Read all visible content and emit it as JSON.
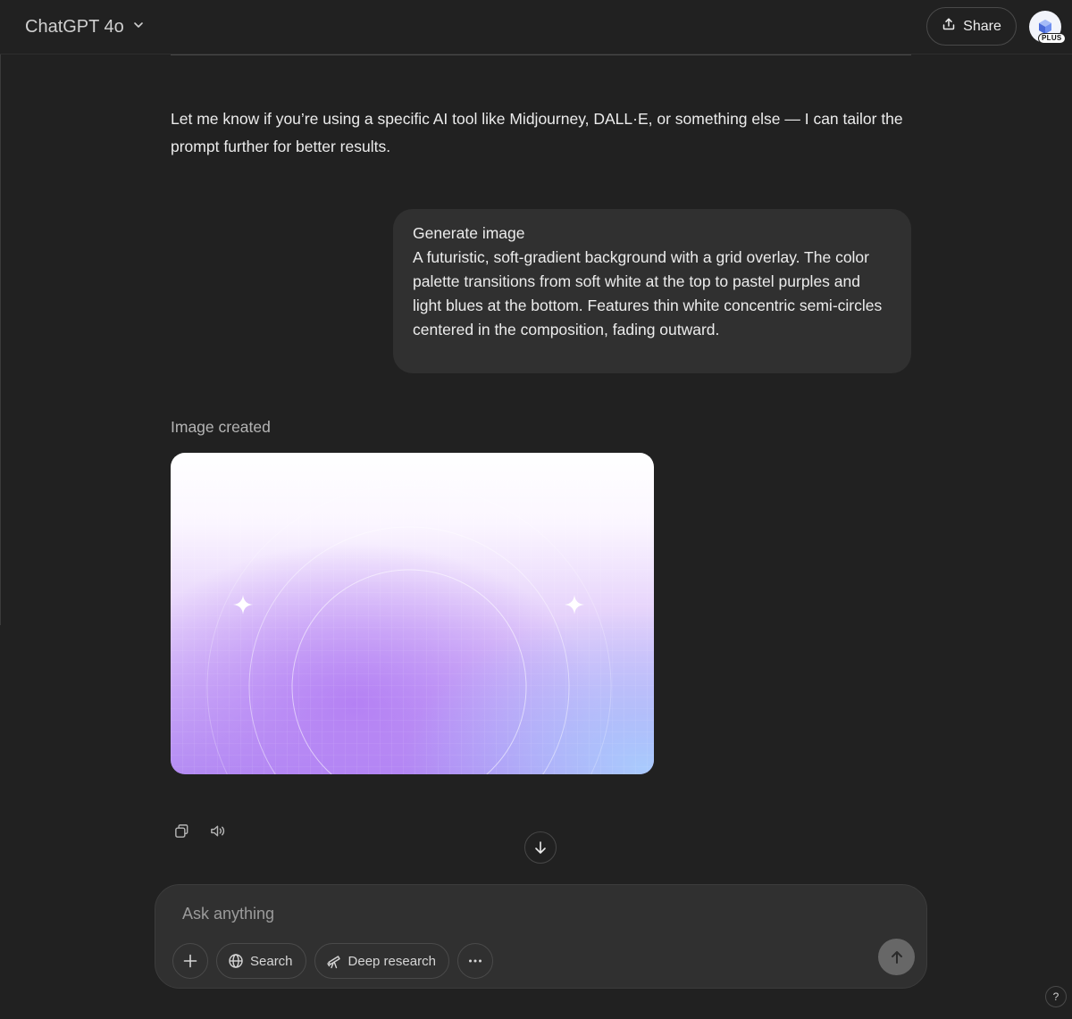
{
  "header": {
    "model_label": "ChatGPT 4o",
    "share_label": "Share",
    "plan_badge": "PLUS"
  },
  "conversation": {
    "assistant_text": "Let me know if you’re using a specific AI tool like Midjourney, DALL·E, or something else — I can tailor the prompt further for better results.",
    "user_message": {
      "title": "Generate image",
      "body": "A futuristic, soft-gradient background with a grid overlay. The color palette transitions from soft white at the top to pastel purples and light blues at the bottom. Features thin white concentric semi-circles centered in the composition, fading outward."
    },
    "image_created_label": "Image created"
  },
  "composer": {
    "placeholder": "Ask anything",
    "tools": {
      "search_label": "Search",
      "deep_research_label": "Deep research"
    }
  },
  "help_label": "?",
  "colors": {
    "background": "#212121",
    "bubble": "#303030",
    "image_top": "#ffffff",
    "image_purple": "#b98cf5",
    "image_blue": "#a9c8fc"
  },
  "icons": {
    "model_switch": "chevron-down-icon",
    "share": "upload-icon",
    "copy": "copy-icon",
    "read_aloud": "speaker-icon",
    "scroll": "arrow-down-icon",
    "attach": "plus-icon",
    "search": "globe-icon",
    "deep_research": "telescope-icon",
    "more": "ellipsis-icon",
    "send": "arrow-up-icon"
  }
}
